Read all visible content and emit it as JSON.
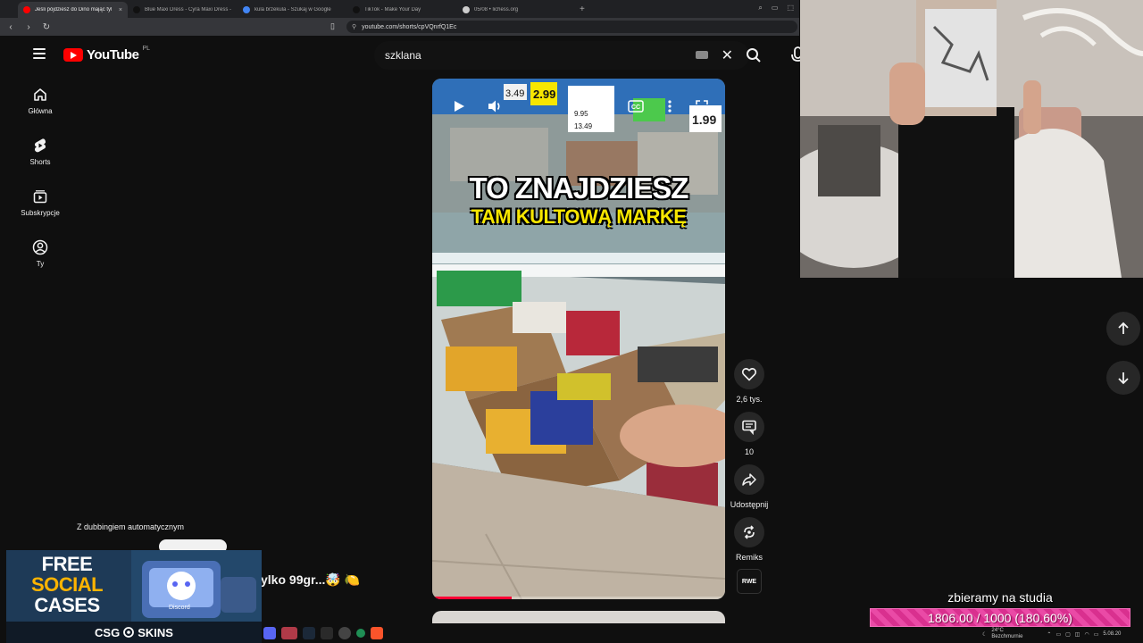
{
  "browser": {
    "tabs": [
      {
        "title": "Jeśli pójdziesz do Dino mając tyl",
        "active": true,
        "favicon_color": "#ff0000"
      },
      {
        "title": "Blue Maxi Dress - Cyra Maxi Dress -",
        "active": false,
        "favicon_color": "#111111"
      },
      {
        "title": "kula brzekula - Szukaj w Google",
        "active": false,
        "favicon_color": "#4285f4"
      },
      {
        "title": "TikTok - Make Your Day",
        "active": false,
        "favicon_color": "#111111"
      },
      {
        "title": "05/08 • lichess.org",
        "active": false,
        "favicon_color": "#cccccc"
      }
    ],
    "tab_close": "×",
    "new_tab": "+",
    "address": "youtube.com/shorts/cpVQnrfQ1Ec"
  },
  "youtube": {
    "logo_text": "YouTube",
    "country": "PL",
    "search_query": "szklana",
    "nav": [
      {
        "label": "Główna",
        "icon": "home-icon"
      },
      {
        "label": "Shorts",
        "icon": "shorts-icon"
      },
      {
        "label": "Subskrypcje",
        "icon": "subscriptions-icon"
      },
      {
        "label": "Ty",
        "icon": "account-icon"
      }
    ]
  },
  "video": {
    "caption_line1": "TO ZNAJDZIESZ",
    "caption_line2": "TAM KULTOWĄ MARKĘ",
    "progress": 0.27,
    "price_tags": [
      "3.49",
      "2.99",
      "9.95",
      "13.49",
      "1.99"
    ],
    "dubbing_note": "Z dubbingiem automatycznym",
    "title_snippet": "ylko 99gr...🤯 🍋"
  },
  "actions": [
    {
      "icon": "like-icon",
      "label": "2,6 tys."
    },
    {
      "icon": "comment-icon",
      "label": "10"
    },
    {
      "icon": "share-icon",
      "label": "Udostępnij"
    },
    {
      "icon": "remix-icon",
      "label": "Remiks"
    }
  ],
  "channel_badge": "RWE",
  "promo": {
    "line1": "FREE",
    "line2": "SOCIAL",
    "line3": "CASES",
    "badge": "Discord",
    "brand": "CSG",
    "brand_suffix": "SKINS",
    "brand_accent": "#ffb400"
  },
  "goal": {
    "label": "zbieramy na studia",
    "current": 1806.0,
    "target": 1000,
    "text": "1806.00 / 1000 (180.60%)",
    "bar_color": "#e84aa6"
  },
  "tray": {
    "weather_line1": "24°C",
    "weather_line2": "Bezchmurnie",
    "date": "5.08.20"
  }
}
